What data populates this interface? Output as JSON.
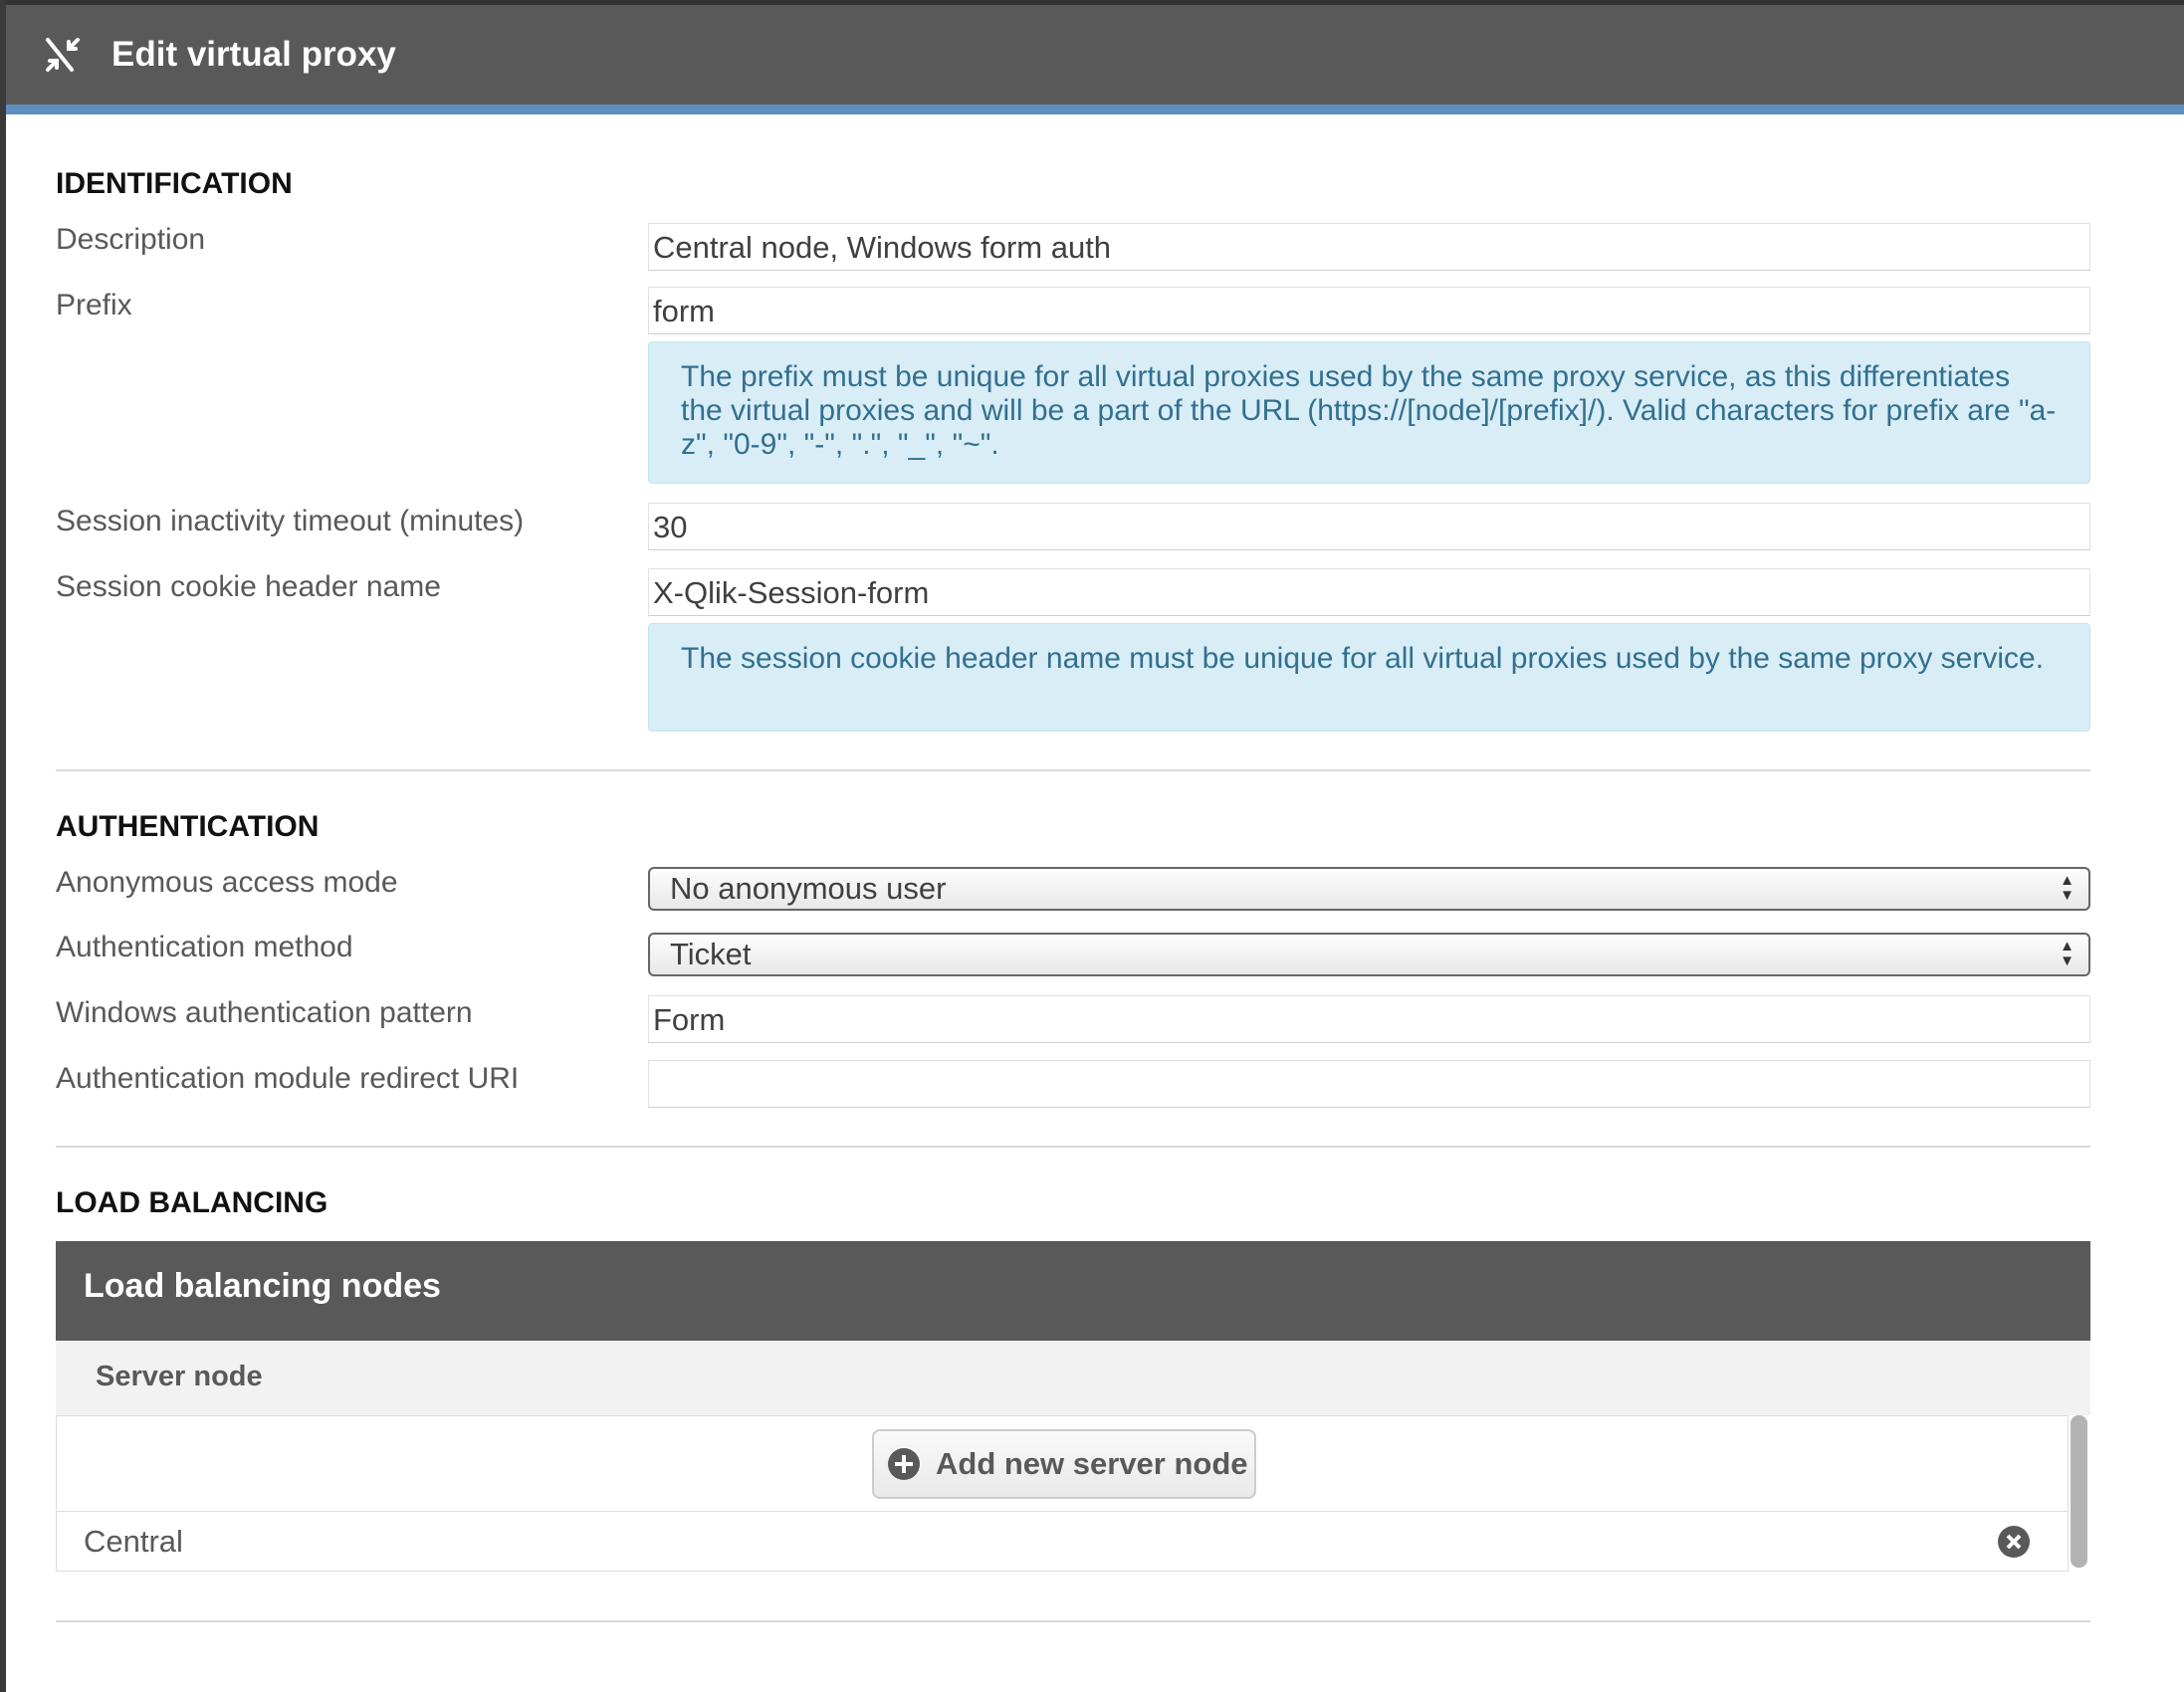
{
  "header": {
    "title": "Edit virtual proxy",
    "icon": "collapse-arrows-icon"
  },
  "identification": {
    "heading": "IDENTIFICATION",
    "description_label": "Description",
    "description_value": "Central node, Windows form auth",
    "prefix_label": "Prefix",
    "prefix_value": "form",
    "prefix_info": "The prefix must be unique for all virtual proxies used by the same proxy service, as this differentiates the virtual proxies and will be a part of the URL (https://[node]/[prefix]/). Valid characters for prefix are \"a-z\", \"0-9\", \"-\", \".\", \"_\", \"~\".",
    "timeout_label": "Session inactivity timeout (minutes)",
    "timeout_value": "30",
    "cookie_label": "Session cookie header name",
    "cookie_value": "X-Qlik-Session-form",
    "cookie_info": "The session cookie header name must be unique for all virtual proxies used by the same proxy service."
  },
  "authentication": {
    "heading": "AUTHENTICATION",
    "anon_label": "Anonymous access mode",
    "anon_value": "No anonymous user",
    "method_label": "Authentication method",
    "method_value": "Ticket",
    "pattern_label": "Windows authentication pattern",
    "pattern_value": "Form",
    "redirect_label": "Authentication module redirect URI",
    "redirect_value": ""
  },
  "load_balancing": {
    "heading": "LOAD BALANCING",
    "table_title": "Load balancing nodes",
    "column": "Server node",
    "add_button": "Add new server node",
    "nodes": [
      {
        "name": "Central"
      }
    ]
  }
}
